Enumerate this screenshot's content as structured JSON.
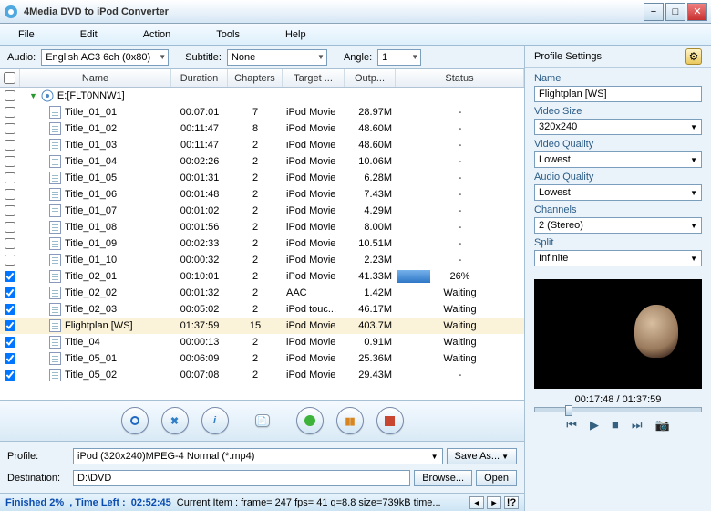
{
  "title": "4Media DVD to iPod Converter",
  "menu": [
    "File",
    "Edit",
    "Action",
    "Tools",
    "Help"
  ],
  "filters": {
    "audio_label": "Audio:",
    "audio_value": "English AC3 6ch (0x80)",
    "subtitle_label": "Subtitle:",
    "subtitle_value": "None",
    "angle_label": "Angle:",
    "angle_value": "1"
  },
  "columns": [
    "",
    "Name",
    "Duration",
    "Chapters",
    "Target ...",
    "Outp...",
    "Status"
  ],
  "group": "E:[FLT0NNW1]",
  "rows": [
    {
      "chk": false,
      "name": "Title_01_01",
      "dur": "00:07:01",
      "chap": "7",
      "tgt": "iPod Movie",
      "out": "28.97M",
      "status": "-"
    },
    {
      "chk": false,
      "name": "Title_01_02",
      "dur": "00:11:47",
      "chap": "8",
      "tgt": "iPod Movie",
      "out": "48.60M",
      "status": "-"
    },
    {
      "chk": false,
      "name": "Title_01_03",
      "dur": "00:11:47",
      "chap": "2",
      "tgt": "iPod Movie",
      "out": "48.60M",
      "status": "-"
    },
    {
      "chk": false,
      "name": "Title_01_04",
      "dur": "00:02:26",
      "chap": "2",
      "tgt": "iPod Movie",
      "out": "10.06M",
      "status": "-"
    },
    {
      "chk": false,
      "name": "Title_01_05",
      "dur": "00:01:31",
      "chap": "2",
      "tgt": "iPod Movie",
      "out": "6.28M",
      "status": "-"
    },
    {
      "chk": false,
      "name": "Title_01_06",
      "dur": "00:01:48",
      "chap": "2",
      "tgt": "iPod Movie",
      "out": "7.43M",
      "status": "-"
    },
    {
      "chk": false,
      "name": "Title_01_07",
      "dur": "00:01:02",
      "chap": "2",
      "tgt": "iPod Movie",
      "out": "4.29M",
      "status": "-"
    },
    {
      "chk": false,
      "name": "Title_01_08",
      "dur": "00:01:56",
      "chap": "2",
      "tgt": "iPod Movie",
      "out": "8.00M",
      "status": "-"
    },
    {
      "chk": false,
      "name": "Title_01_09",
      "dur": "00:02:33",
      "chap": "2",
      "tgt": "iPod Movie",
      "out": "10.51M",
      "status": "-"
    },
    {
      "chk": false,
      "name": "Title_01_10",
      "dur": "00:00:32",
      "chap": "2",
      "tgt": "iPod Movie",
      "out": "2.23M",
      "status": "-"
    },
    {
      "chk": true,
      "name": "Title_02_01",
      "dur": "00:10:01",
      "chap": "2",
      "tgt": "iPod Movie",
      "out": "41.33M",
      "status": "26%",
      "progress": 26
    },
    {
      "chk": true,
      "name": "Title_02_02",
      "dur": "00:01:32",
      "chap": "2",
      "tgt": "AAC",
      "out": "1.42M",
      "status": "Waiting"
    },
    {
      "chk": true,
      "name": "Title_02_03",
      "dur": "00:05:02",
      "chap": "2",
      "tgt": "iPod touc...",
      "out": "46.17M",
      "status": "Waiting"
    },
    {
      "chk": true,
      "name": "Flightplan [WS]",
      "dur": "01:37:59",
      "chap": "15",
      "tgt": "iPod Movie",
      "out": "403.7M",
      "status": "Waiting",
      "hl": true
    },
    {
      "chk": true,
      "name": "Title_04",
      "dur": "00:00:13",
      "chap": "2",
      "tgt": "iPod Movie",
      "out": "0.91M",
      "status": "Waiting"
    },
    {
      "chk": true,
      "name": "Title_05_01",
      "dur": "00:06:09",
      "chap": "2",
      "tgt": "iPod Movie",
      "out": "25.36M",
      "status": "Waiting"
    },
    {
      "chk": true,
      "name": "Title_05_02",
      "dur": "00:07:08",
      "chap": "2",
      "tgt": "iPod Movie",
      "out": "29.43M",
      "status": "-"
    }
  ],
  "bottom": {
    "profile_label": "Profile:",
    "profile_value": "iPod (320x240)MPEG-4 Normal  (*.mp4)",
    "save_as": "Save As...",
    "dest_label": "Destination:",
    "dest_value": "D:\\DVD",
    "browse": "Browse...",
    "open": "Open"
  },
  "status": {
    "finished": "Finished 2%   ",
    "timeleft_label": ", Time Left :  ",
    "timeleft": "02:52:45",
    "item": "Current Item : frame=  247 fps= 41 q=8.8 size=739kB time..."
  },
  "props": {
    "header": "Profile Settings",
    "fields": [
      {
        "label": "Name",
        "value": "Flightplan [WS]",
        "type": "input"
      },
      {
        "label": "Video Size",
        "value": "320x240",
        "type": "combo"
      },
      {
        "label": "Video Quality",
        "value": "Lowest",
        "type": "combo"
      },
      {
        "label": "Audio Quality",
        "value": "Lowest",
        "type": "combo"
      },
      {
        "label": "Channels",
        "value": "2 (Stereo)",
        "type": "combo"
      },
      {
        "label": "Split",
        "value": "Infinite",
        "type": "combo"
      }
    ]
  },
  "preview": {
    "time": "00:17:48 / 01:37:59",
    "pos": 18
  }
}
